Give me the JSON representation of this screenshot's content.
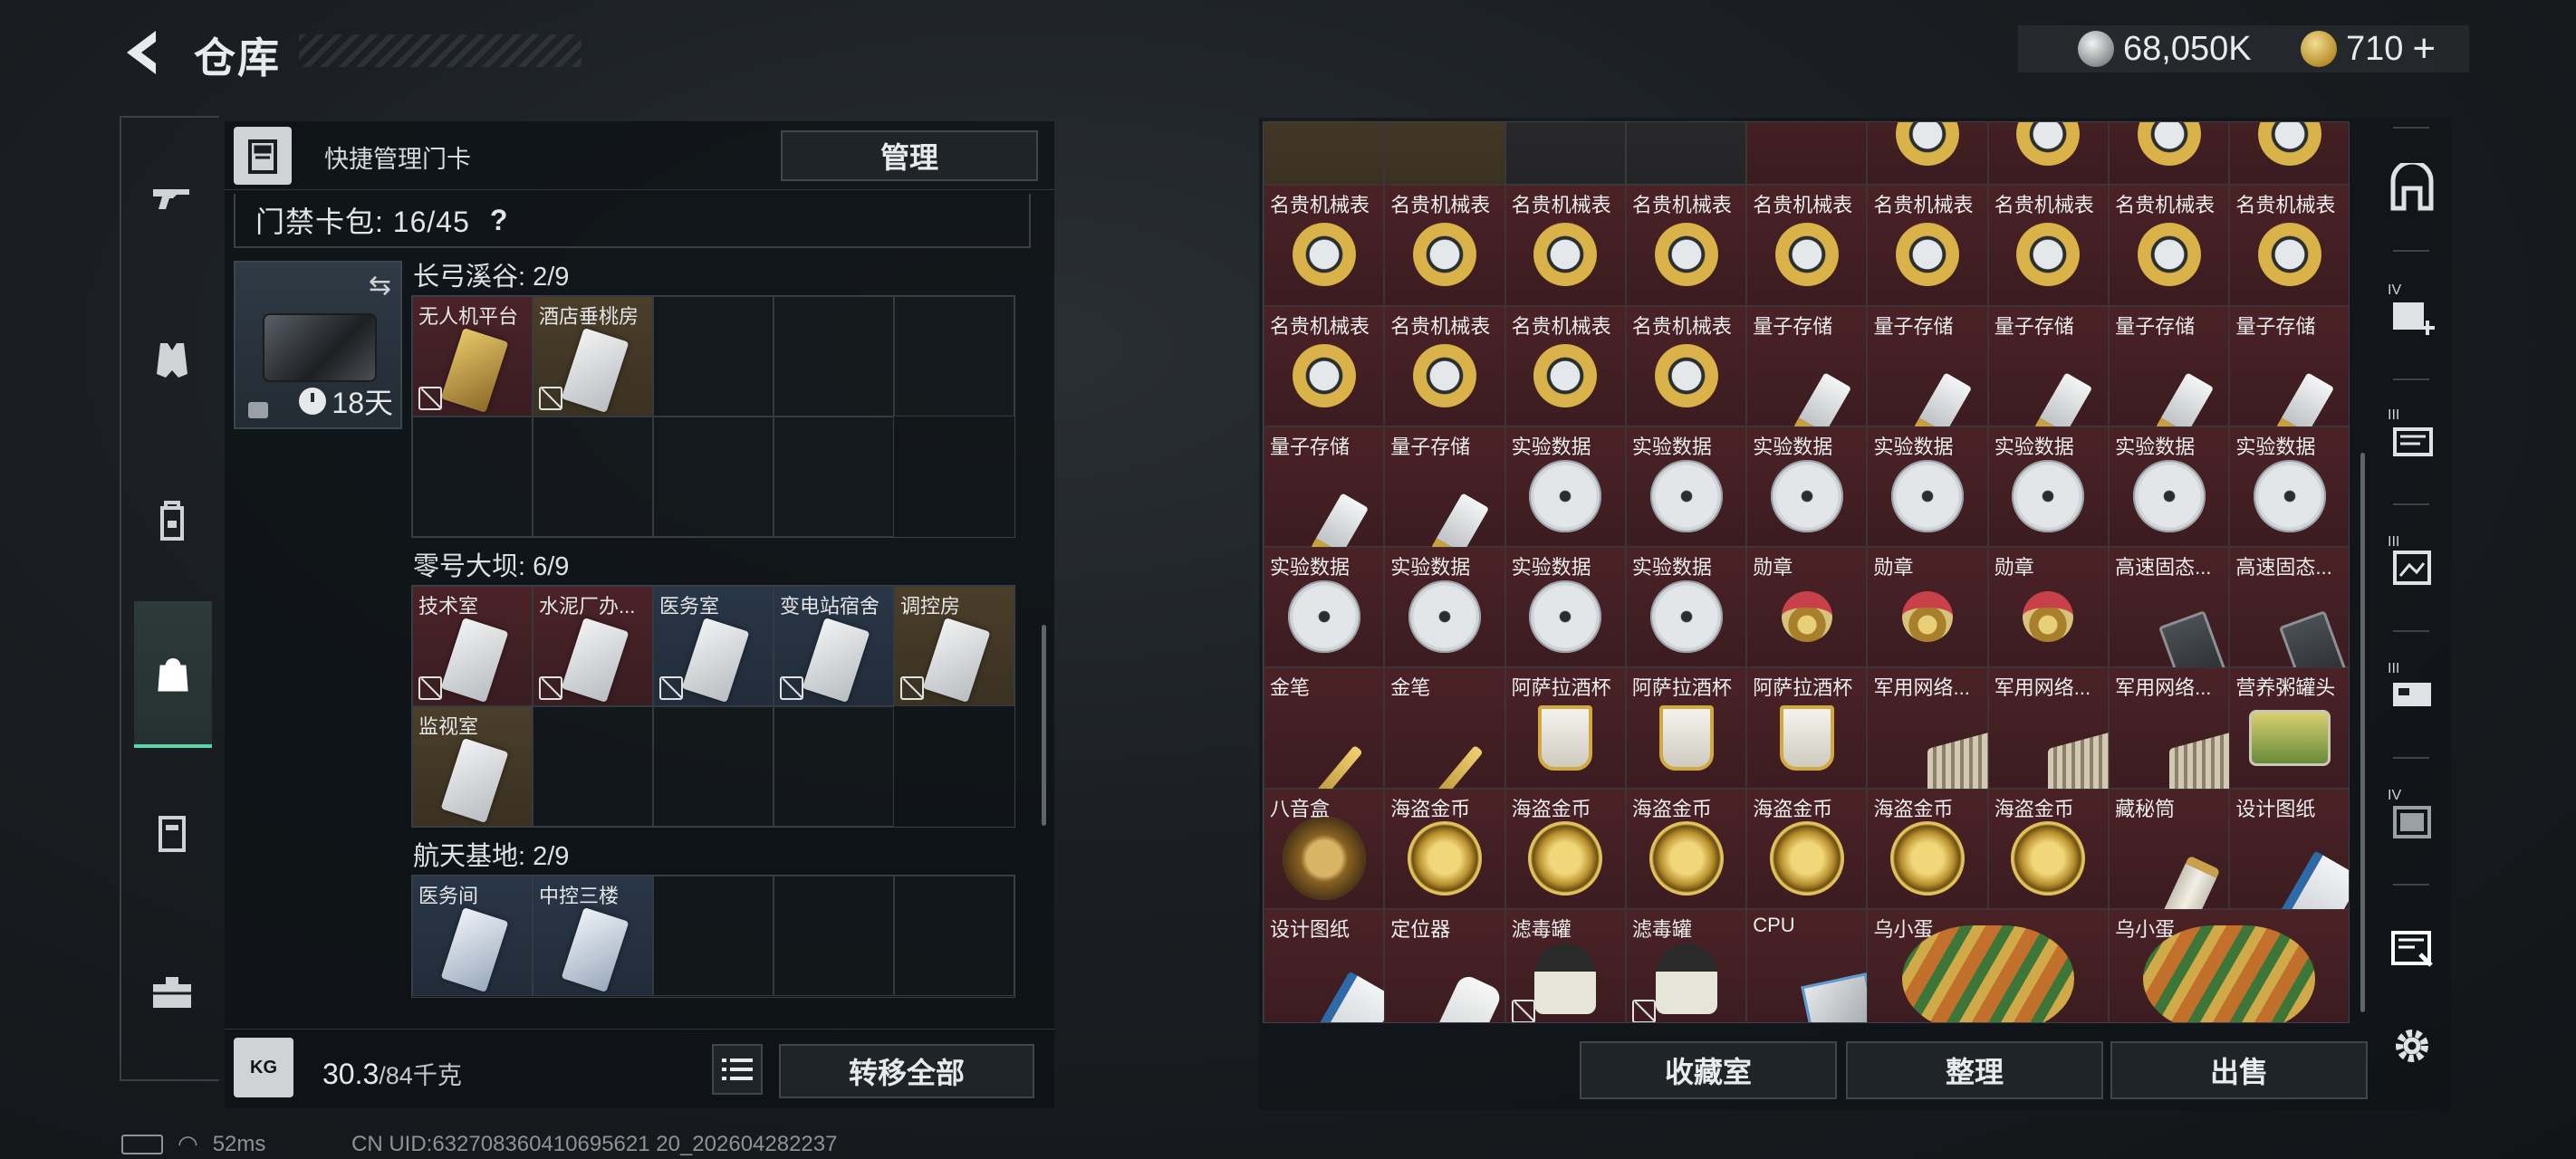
{
  "header": {
    "title": "仓库",
    "currency_silver": "68,050K",
    "currency_gold": "710",
    "add_label": "+"
  },
  "left_panel": {
    "header_label": "快捷管理门卡",
    "manage_label": "管理",
    "card_pack_label": "门禁卡包: 16/45",
    "card_pack_help": "?",
    "keycase_days": "18天",
    "sections": [
      {
        "title": "长弓溪谷: 2/9",
        "cells": [
          {
            "label": "无人机平台",
            "tone": "red",
            "card": "goldc",
            "nodelete": true
          },
          {
            "label": "酒店垂桃房",
            "tone": "gold",
            "card": "",
            "nodelete": true
          },
          {
            "label": "",
            "tone": ""
          },
          {
            "label": "",
            "tone": ""
          },
          {
            "label": "",
            "tone": ""
          },
          {
            "label": "",
            "tone": ""
          },
          {
            "label": "",
            "tone": ""
          },
          {
            "label": "",
            "tone": ""
          },
          {
            "label": "",
            "tone": ""
          }
        ]
      },
      {
        "title": "零号大坝: 6/9",
        "cells": [
          {
            "label": "技术室",
            "tone": "red",
            "card": "",
            "nodelete": true
          },
          {
            "label": "水泥厂办...",
            "tone": "red",
            "card": "",
            "nodelete": true
          },
          {
            "label": "医务室",
            "tone": "blue",
            "card": "",
            "nodelete": true
          },
          {
            "label": "变电站宿舍",
            "tone": "blue",
            "card": "",
            "nodelete": true
          },
          {
            "label": "调控房",
            "tone": "gold",
            "card": "",
            "nodelete": true
          },
          {
            "label": "监视室",
            "tone": "gold",
            "card": "",
            "nodelete": false
          },
          {
            "label": "",
            "tone": ""
          },
          {
            "label": "",
            "tone": ""
          },
          {
            "label": "",
            "tone": ""
          }
        ]
      },
      {
        "title": "航天基地: 2/9",
        "cells": [
          {
            "label": "医务间",
            "tone": "blue",
            "card": "bluec",
            "nodelete": false
          },
          {
            "label": "中控三楼",
            "tone": "blue",
            "card": "bluec",
            "nodelete": false
          },
          {
            "label": "",
            "tone": ""
          },
          {
            "label": "",
            "tone": ""
          },
          {
            "label": "",
            "tone": ""
          }
        ]
      }
    ],
    "weight_icon": "KG",
    "weight_value": "30.3",
    "weight_max": "/84千克",
    "transfer_all_label": "转移全部"
  },
  "right_panel": {
    "rows": [
      [
        {
          "label": "",
          "icon": "none",
          "tone": "gold"
        },
        {
          "label": "",
          "icon": "none",
          "tone": "gold"
        },
        {
          "label": "",
          "icon": "none",
          "tone": "dark"
        },
        {
          "label": "",
          "icon": "none",
          "tone": "dark"
        },
        {
          "label": "",
          "icon": "none",
          "tone": "red"
        },
        {
          "label": "",
          "icon": "watch",
          "tone": "red"
        },
        {
          "label": "",
          "icon": "watch",
          "tone": "red"
        },
        {
          "label": "",
          "icon": "watch",
          "tone": "red"
        },
        {
          "label": "",
          "icon": "watch",
          "tone": "red"
        }
      ],
      [
        {
          "label": "名贵机械表",
          "icon": "watch",
          "tone": "red"
        },
        {
          "label": "名贵机械表",
          "icon": "watch",
          "tone": "red"
        },
        {
          "label": "名贵机械表",
          "icon": "watch",
          "tone": "red"
        },
        {
          "label": "名贵机械表",
          "icon": "watch",
          "tone": "red"
        },
        {
          "label": "名贵机械表",
          "icon": "watch",
          "tone": "red"
        },
        {
          "label": "名贵机械表",
          "icon": "watch",
          "tone": "red"
        },
        {
          "label": "名贵机械表",
          "icon": "watch",
          "tone": "red"
        },
        {
          "label": "名贵机械表",
          "icon": "watch",
          "tone": "red"
        },
        {
          "label": "名贵机械表",
          "icon": "watch",
          "tone": "red"
        }
      ],
      [
        {
          "label": "名贵机械表",
          "icon": "watch",
          "tone": "red"
        },
        {
          "label": "名贵机械表",
          "icon": "watch",
          "tone": "red"
        },
        {
          "label": "名贵机械表",
          "icon": "watch",
          "tone": "red"
        },
        {
          "label": "名贵机械表",
          "icon": "watch",
          "tone": "red"
        },
        {
          "label": "量子存储",
          "icon": "usb",
          "tone": "red"
        },
        {
          "label": "量子存储",
          "icon": "usb",
          "tone": "red"
        },
        {
          "label": "量子存储",
          "icon": "usb",
          "tone": "red"
        },
        {
          "label": "量子存储",
          "icon": "usb",
          "tone": "red"
        },
        {
          "label": "量子存储",
          "icon": "usb",
          "tone": "red"
        }
      ],
      [
        {
          "label": "量子存储",
          "icon": "usb",
          "tone": "red"
        },
        {
          "label": "量子存储",
          "icon": "usb",
          "tone": "red"
        },
        {
          "label": "实验数据",
          "icon": "disc",
          "tone": "red"
        },
        {
          "label": "实验数据",
          "icon": "disc",
          "tone": "red"
        },
        {
          "label": "实验数据",
          "icon": "disc",
          "tone": "red"
        },
        {
          "label": "实验数据",
          "icon": "disc",
          "tone": "red"
        },
        {
          "label": "实验数据",
          "icon": "disc",
          "tone": "red"
        },
        {
          "label": "实验数据",
          "icon": "disc",
          "tone": "red"
        },
        {
          "label": "实验数据",
          "icon": "disc",
          "tone": "red"
        }
      ],
      [
        {
          "label": "实验数据",
          "icon": "disc",
          "tone": "red"
        },
        {
          "label": "实验数据",
          "icon": "disc",
          "tone": "red"
        },
        {
          "label": "实验数据",
          "icon": "disc",
          "tone": "red"
        },
        {
          "label": "实验数据",
          "icon": "disc",
          "tone": "red"
        },
        {
          "label": "勋章",
          "icon": "medal",
          "tone": "red"
        },
        {
          "label": "勋章",
          "icon": "medal",
          "tone": "red"
        },
        {
          "label": "勋章",
          "icon": "medal",
          "tone": "red"
        },
        {
          "label": "高速固态...",
          "icon": "ssd",
          "tone": "red"
        },
        {
          "label": "高速固态...",
          "icon": "ssd",
          "tone": "red"
        }
      ],
      [
        {
          "label": "金笔",
          "icon": "pen",
          "tone": "red"
        },
        {
          "label": "金笔",
          "icon": "pen",
          "tone": "red"
        },
        {
          "label": "阿萨拉酒杯",
          "icon": "cup",
          "tone": "red"
        },
        {
          "label": "阿萨拉酒杯",
          "icon": "cup",
          "tone": "red"
        },
        {
          "label": "阿萨拉酒杯",
          "icon": "cup",
          "tone": "red"
        },
        {
          "label": "军用网络...",
          "icon": "net",
          "tone": "red"
        },
        {
          "label": "军用网络...",
          "icon": "net",
          "tone": "red"
        },
        {
          "label": "军用网络...",
          "icon": "net",
          "tone": "red"
        },
        {
          "label": "营养粥罐头",
          "icon": "can",
          "tone": "red"
        }
      ],
      [
        {
          "label": "八音盒",
          "icon": "musicbox",
          "tone": "red"
        },
        {
          "label": "海盗金币",
          "icon": "coin2",
          "tone": "red"
        },
        {
          "label": "海盗金币",
          "icon": "coin2",
          "tone": "red"
        },
        {
          "label": "海盗金币",
          "icon": "coin2",
          "tone": "red"
        },
        {
          "label": "海盗金币",
          "icon": "coin2",
          "tone": "red"
        },
        {
          "label": "海盗金币",
          "icon": "coin2",
          "tone": "red"
        },
        {
          "label": "海盗金币",
          "icon": "coin2",
          "tone": "red"
        },
        {
          "label": "藏秘筒",
          "icon": "scroll",
          "tone": "red"
        },
        {
          "label": "设计图纸",
          "icon": "blueprint",
          "tone": "red"
        }
      ],
      [
        {
          "label": "设计图纸",
          "icon": "blueprint",
          "tone": "red"
        },
        {
          "label": "定位器",
          "icon": "locator",
          "tone": "red"
        },
        {
          "label": "滤毒罐",
          "icon": "filter",
          "tone": "red",
          "nodelete": true
        },
        {
          "label": "滤毒罐",
          "icon": "filter",
          "tone": "red",
          "nodelete": true
        },
        {
          "label": "CPU",
          "icon": "cpu",
          "tone": "red"
        },
        {
          "label": "乌小蛋",
          "icon": "egg",
          "tone": "red",
          "span": 2
        },
        {
          "label": "乌小蛋",
          "icon": "egg",
          "tone": "red",
          "span": 2
        }
      ]
    ],
    "collection_label": "收藏室",
    "sort_label": "整理",
    "sell_label": "出售"
  },
  "status_bar": {
    "ping": "52ms",
    "uid": "CN UID:632708360410695621 20_202604282237"
  }
}
